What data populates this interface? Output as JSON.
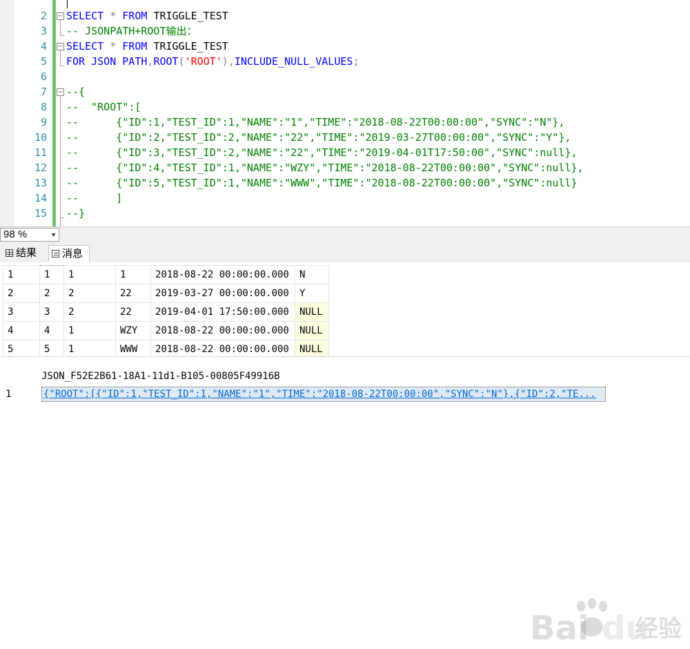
{
  "editor": {
    "line_numbers": [
      "2",
      "3",
      "4",
      "5",
      "6",
      "7",
      "8",
      "9",
      "10",
      "11",
      "12",
      "13",
      "14",
      "15"
    ],
    "line2": {
      "kw1": "SELECT",
      "op": " * ",
      "kw2": "FROM",
      "rest": " TRIGGLE_TEST"
    },
    "line3": "-- JSONPATH+ROOT输出：",
    "line4": {
      "kw1": "SELECT",
      "op": " * ",
      "kw2": "FROM",
      "rest": " TRIGGLE_TEST"
    },
    "line5": {
      "kw1": "FOR JSON PATH",
      "c1": ",",
      "kw2": "ROOT",
      "p1": "(",
      "str": "'ROOT'",
      "p2": ")",
      "c2": ",",
      "kw3": "INCLUDE_NULL_VALUES",
      "semi": ";"
    },
    "line7": "--{",
    "line8": "--  \"ROOT\":[",
    "line9": "--      {\"ID\":1,\"TEST_ID\":1,\"NAME\":\"1\",\"TIME\":\"2018-08-22T00:00:00\",\"SYNC\":\"N\"},",
    "line10": "--      {\"ID\":2,\"TEST_ID\":2,\"NAME\":\"22\",\"TIME\":\"2019-03-27T00:00:00\",\"SYNC\":\"Y\"},",
    "line11": "--      {\"ID\":3,\"TEST_ID\":2,\"NAME\":\"22\",\"TIME\":\"2019-04-01T17:50:00\",\"SYNC\":null},",
    "line12": "--      {\"ID\":4,\"TEST_ID\":1,\"NAME\":\"WZY\",\"TIME\":\"2018-08-22T00:00:00\",\"SYNC\":null},",
    "line13": "--      {\"ID\":5,\"TEST_ID\":1,\"NAME\":\"WWW\",\"TIME\":\"2018-08-22T00:00:00\",\"SYNC\":null}",
    "line14": "--      ]",
    "line15": "--}"
  },
  "zoom": {
    "value": "98 %"
  },
  "tabs": {
    "results": "结果",
    "messages": "消息"
  },
  "grid1": {
    "rows": [
      [
        "1",
        "1",
        "1",
        "1",
        "2018-08-22 00:00:00.000",
        "N"
      ],
      [
        "2",
        "2",
        "2",
        "22",
        "2019-03-27 00:00:00.000",
        "Y"
      ],
      [
        "3",
        "3",
        "2",
        "22",
        "2019-04-01 17:50:00.000",
        "NULL"
      ],
      [
        "4",
        "4",
        "1",
        "WZY",
        "2018-08-22 00:00:00.000",
        "NULL"
      ],
      [
        "5",
        "5",
        "1",
        "WWW",
        "2018-08-22 00:00:00.000",
        "NULL"
      ]
    ]
  },
  "grid2": {
    "header": "JSON_F52E2B61-18A1-11d1-B105-00805F49916B",
    "row_number": "1",
    "value": "{\"ROOT\":[{\"ID\":1,\"TEST_ID\":1,\"NAME\":\"1\",\"TIME\":\"2018-08-22T00:00:00\",\"SYNC\":\"N\"},{\"ID\":2,\"TE..."
  },
  "watermark": {
    "text": "Bai",
    "text2": "du",
    "text3": "经验"
  },
  "colors": {
    "keyword": "#0000ff",
    "comment": "#008000",
    "string": "#ff0000",
    "line_number": "#2b91af",
    "null_cell": "#fffde0"
  }
}
